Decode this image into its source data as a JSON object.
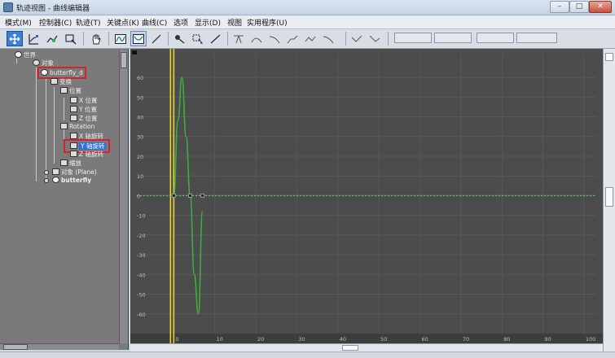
{
  "window": {
    "title": "轨迹视图 - 曲线编辑器",
    "controls": [
      "–",
      "□",
      "✕"
    ]
  },
  "menu": [
    "模式(M)",
    "控制器(C)",
    "轨迹(T)",
    "关键点(K)",
    "曲线(C)",
    "选项",
    "显示(D)",
    "视图",
    "实用程序(U)"
  ],
  "toolbar": {
    "tools": [
      "move-keys-icon",
      "slide-keys-icon",
      "scale-values-icon",
      "add-keys-icon",
      "pan-icon",
      "fit-icon",
      "zoom-icon",
      "frame-icon",
      "key-tangent-icon",
      "tangent-auto-icon",
      "tangent-custom-icon",
      "tangent-fast-icon",
      "tangent-slow-icon",
      "tangent-step-icon",
      "tangent-linear-icon",
      "tangent-smooth-icon"
    ],
    "slots": [
      "",
      "",
      "",
      ""
    ]
  },
  "tree": {
    "nodes": [
      {
        "label": "世界",
        "depth": 0
      },
      {
        "label": "对象",
        "depth": 1
      },
      {
        "label": "butterfly_d",
        "depth": 2,
        "highlight": true
      },
      {
        "label": "变换",
        "depth": 3
      },
      {
        "label": "位置",
        "depth": 4
      },
      {
        "label": "X 位置",
        "depth": 5
      },
      {
        "label": "Y 位置",
        "depth": 5
      },
      {
        "label": "Z 位置",
        "depth": 5
      },
      {
        "label": "Rotation",
        "depth": 4
      },
      {
        "label": "X 轴旋转",
        "depth": 5
      },
      {
        "label": "Y 轴旋转",
        "depth": 5,
        "selected": true,
        "highlight": true
      },
      {
        "label": "Z 轴旋转",
        "depth": 5
      },
      {
        "label": "缩放",
        "depth": 4
      },
      {
        "label": "对象 (Plane)",
        "depth": 3
      },
      {
        "label": "butterfly",
        "depth": 3,
        "bold": true
      }
    ]
  },
  "chart_data": {
    "type": "line",
    "x_ticks": [
      0,
      10,
      20,
      30,
      40,
      50,
      60,
      70,
      80,
      90,
      100
    ],
    "y_ticks": [
      60,
      50,
      40,
      30,
      20,
      10,
      0,
      -10,
      -20,
      -30,
      -40,
      -50,
      -60
    ],
    "xlim": [
      -9,
      103
    ],
    "ylim": [
      -70,
      72
    ],
    "current_frame": 0,
    "series": [
      {
        "color": "#3fae3f",
        "x": [
          0,
          1,
          2,
          3,
          4,
          5,
          6,
          7
        ],
        "y": [
          0,
          38,
          60,
          30,
          0,
          -40,
          -60,
          -8
        ]
      },
      {
        "color": "#6fd36f",
        "x": [
          -9,
          103
        ],
        "y": [
          0,
          0
        ]
      }
    ],
    "keys": [
      {
        "x": 0,
        "y": 0
      },
      {
        "x": 4,
        "y": 0
      },
      {
        "x": 7,
        "y": 0
      }
    ]
  },
  "colors": {
    "graph_bg": "#4c4c4c",
    "grid": "#585858",
    "time_marker": "#e8d233",
    "highlight_box": "#d4232a",
    "selection": "#2f6fd8"
  }
}
